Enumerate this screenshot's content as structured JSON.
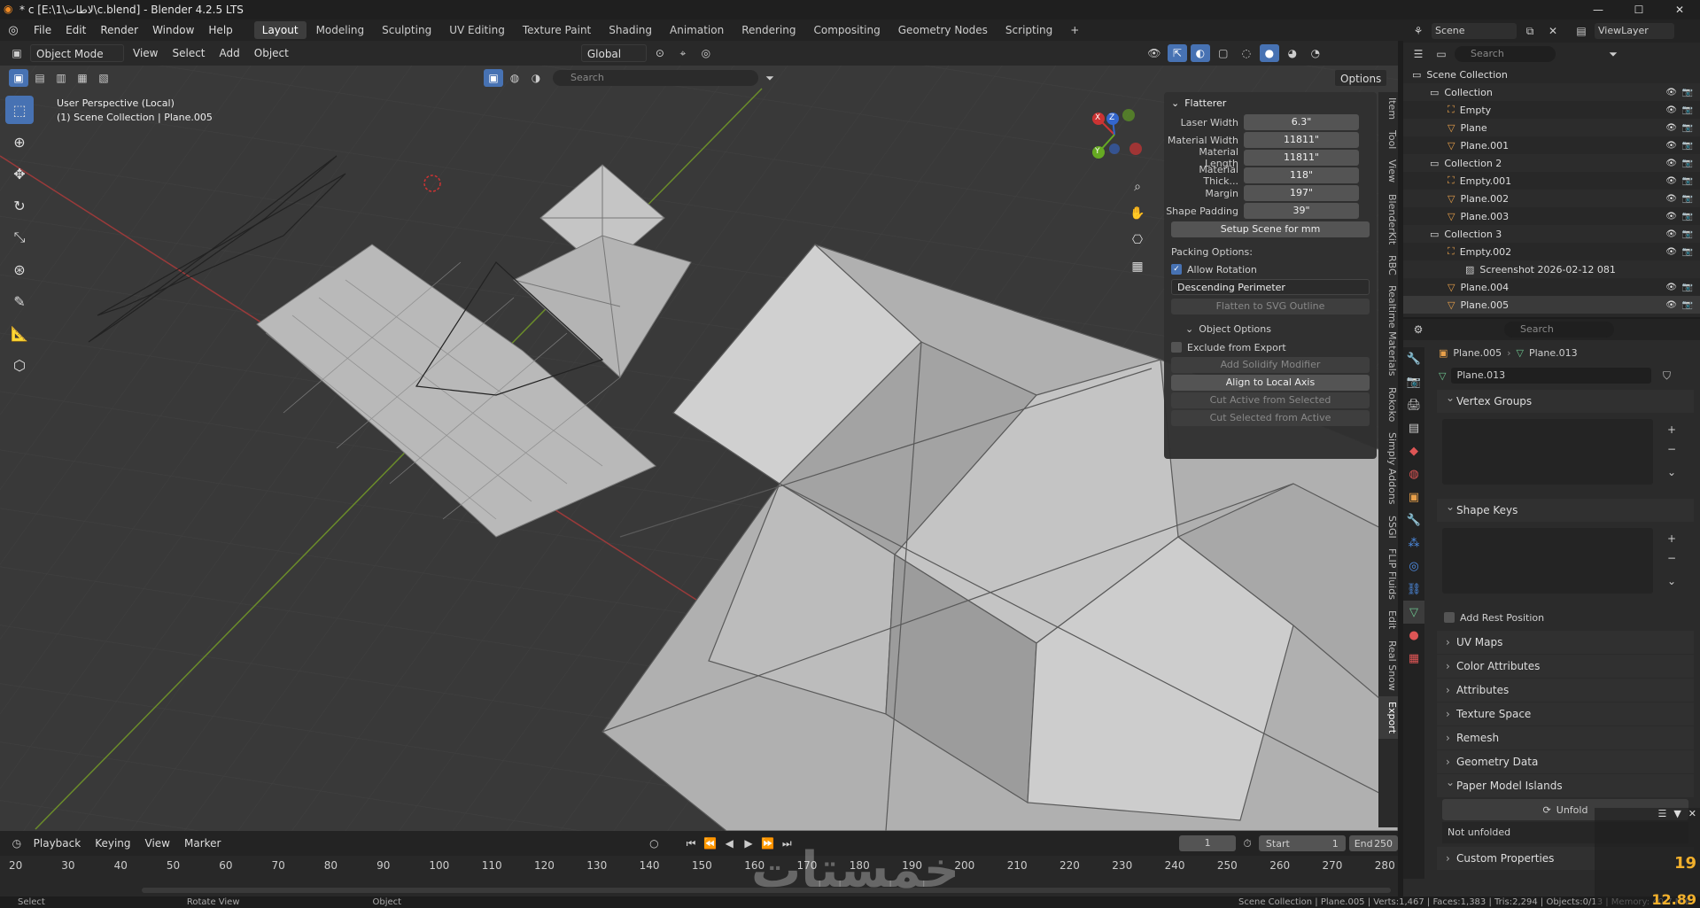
{
  "window": {
    "title": "* c [E:\\1\\لاطات\\c.blend] - Blender 4.2.5 LTS",
    "minimize": "—",
    "maximize": "☐",
    "close": "✕"
  },
  "menu": [
    "File",
    "Edit",
    "Render",
    "Window",
    "Help"
  ],
  "workspaces": [
    "Layout",
    "Modeling",
    "Sculpting",
    "UV Editing",
    "Texture Paint",
    "Shading",
    "Animation",
    "Rendering",
    "Compositing",
    "Geometry Nodes",
    "Scripting"
  ],
  "active_workspace": "Layout",
  "add_workspace": "+",
  "viewport": {
    "mode": "Object Mode",
    "menu": [
      "View",
      "Select",
      "Add",
      "Object"
    ],
    "orientation": "Global",
    "options": "Options",
    "search_placeholder": "Search",
    "info_line1": "User Perspective (Local)",
    "info_line2": "(1) Scene Collection | Plane.005",
    "gizmo": {
      "x": "X",
      "y": "Y",
      "z": "Z"
    }
  },
  "flatterer": {
    "title": "Flatterer",
    "fields": [
      {
        "label": "Laser Width",
        "value": "6.3\""
      },
      {
        "label": "Material Width",
        "value": "11811\""
      },
      {
        "label": "Material Length",
        "value": "11811\""
      },
      {
        "label": "Material Thick...",
        "value": "118\""
      },
      {
        "label": "Margin",
        "value": "197\""
      },
      {
        "label": "Shape Padding",
        "value": "39\""
      }
    ],
    "setup_button": "Setup Scene for mm",
    "packing_label": "Packing Options:",
    "allow_rotation": "Allow Rotation",
    "sort_select": "Descending Perimeter",
    "flatten_button": "Flatten to SVG Outline",
    "object_options": "Object Options",
    "exclude": "Exclude from Export",
    "buttons": [
      {
        "label": "Add Solidify Modifier",
        "enabled": false
      },
      {
        "label": "Align to Local Axis",
        "enabled": true
      },
      {
        "label": "Cut Active from Selected",
        "enabled": false
      },
      {
        "label": "Cut Selected from Active",
        "enabled": false
      }
    ]
  },
  "side_tabs": [
    "Item",
    "Tool",
    "View",
    "BlenderKit",
    "RBC",
    "Realtime Materials",
    "Rokoko",
    "Simply Addons",
    "SSGI",
    "FLIP Fluids",
    "Edit",
    "Real Snow",
    "Export"
  ],
  "outliner": {
    "scene": "Scene",
    "view_layer": "ViewLayer",
    "search_placeholder": "Search",
    "rows": [
      {
        "indent": 0,
        "name": "Scene Collection",
        "kind": "scene"
      },
      {
        "indent": 1,
        "name": "Collection",
        "kind": "collection"
      },
      {
        "indent": 2,
        "name": "Empty",
        "kind": "empty"
      },
      {
        "indent": 2,
        "name": "Plane",
        "kind": "mesh"
      },
      {
        "indent": 2,
        "name": "Plane.001",
        "kind": "mesh"
      },
      {
        "indent": 1,
        "name": "Collection 2",
        "kind": "collection"
      },
      {
        "indent": 2,
        "name": "Empty.001",
        "kind": "empty"
      },
      {
        "indent": 2,
        "name": "Plane.002",
        "kind": "mesh"
      },
      {
        "indent": 2,
        "name": "Plane.003",
        "kind": "mesh"
      },
      {
        "indent": 1,
        "name": "Collection 3",
        "kind": "collection"
      },
      {
        "indent": 2,
        "name": "Empty.002",
        "kind": "empty"
      },
      {
        "indent": 3,
        "name": "Screenshot 2026-02-12 081",
        "kind": "image"
      },
      {
        "indent": 2,
        "name": "Plane.004",
        "kind": "mesh"
      },
      {
        "indent": 2,
        "name": "Plane.005",
        "kind": "mesh"
      }
    ]
  },
  "properties": {
    "search_placeholder": "Search",
    "breadcrumb_object": "Plane.005",
    "breadcrumb_data": "Plane.013",
    "data_name": "Plane.013",
    "sections": [
      "Vertex Groups",
      "Shape Keys"
    ],
    "add_rest_position": "Add Rest Position",
    "collapsed": [
      "UV Maps",
      "Color Attributes",
      "Attributes",
      "Texture Space",
      "Remesh",
      "Geometry Data"
    ],
    "paper_model": "Paper Model Islands",
    "unfold": "Unfold",
    "not_unfolded": "Not unfolded",
    "custom_props": "Custom Properties"
  },
  "timeline": {
    "menu": [
      "Playback",
      "Keying",
      "View",
      "Marker"
    ],
    "current_frame": "1",
    "start_label": "Start",
    "start": "1",
    "end_label": "End",
    "end": "250",
    "ticks": [
      "20",
      "30",
      "40",
      "50",
      "60",
      "70",
      "80",
      "90",
      "100",
      "110",
      "120",
      "130",
      "140",
      "150",
      "160",
      "170",
      "180",
      "190",
      "200",
      "210",
      "220",
      "230",
      "240",
      "250",
      "260",
      "270",
      "280"
    ]
  },
  "status": {
    "left": [
      "Select",
      "Rotate View",
      "Object"
    ],
    "right": "Scene Collection | Plane.005 | Verts:1,467 | Faces:1,383 | Tris:2,294 | Objects:0/13 | Memory: 40.7 MiB",
    "overlay_num1": "19",
    "overlay_num2": "12.89"
  },
  "watermark": "خمستات"
}
